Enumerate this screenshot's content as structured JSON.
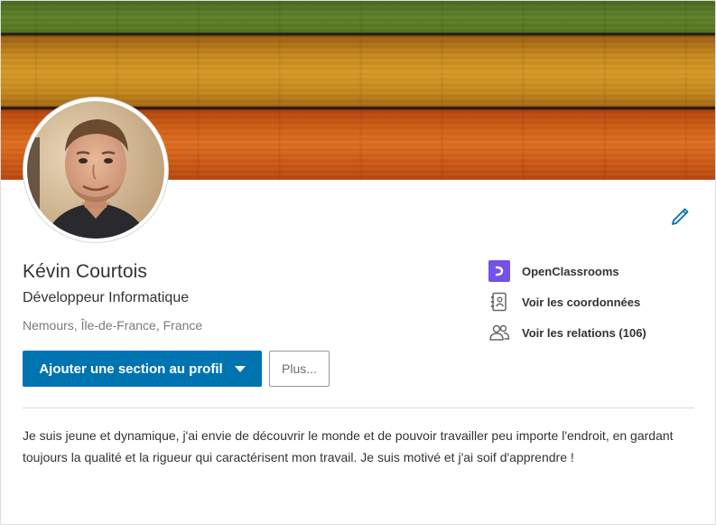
{
  "profile": {
    "name": "Kévin Courtois",
    "headline": "Développeur Informatique",
    "location": "Nemours, Île-de-France, France",
    "summary": "Je suis jeune et dynamique, j'ai envie de découvrir le monde et de pouvoir travailler peu importe l'endroit, en gardant toujours la qualité et la rigueur qui caractérisent mon travail. Je suis motivé et j'ai soif d'apprendre !"
  },
  "actions": {
    "add_section_label": "Ajouter une section au profil",
    "more_label": "Plus..."
  },
  "side": {
    "company": "OpenClassrooms",
    "contact_info": "Voir les coordonnées",
    "connections": "Voir les relations (106)"
  },
  "icons": {
    "edit": "pencil-icon",
    "company": "openclassrooms-logo",
    "contact": "address-book-icon",
    "connections": "people-icon",
    "dropdown": "caret-down-icon"
  },
  "colors": {
    "primary": "#0073b1",
    "company_logo": "#7451eb"
  }
}
